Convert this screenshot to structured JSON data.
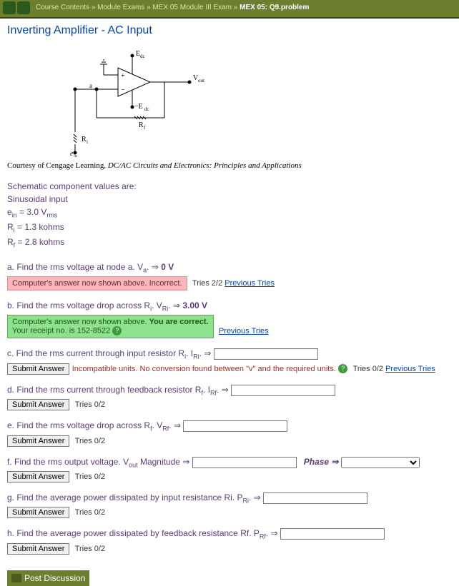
{
  "breadcrumb_raw": "Course Contents » Module Exams » MEX 05 Module III Exam »",
  "breadcrumb_current": "MEX 05: Q9.problem",
  "title": "Inverting Amplifier - AC Input",
  "credit_prefix": "Courtesy of Cengage Learning, ",
  "credit_italic": "DC/AC Circuits and Electronics: Principles and Applications",
  "schem": {
    "Edc": "E_dc",
    "nEdc": "−E_dc",
    "Vout": "V_out",
    "Rf": "R_f",
    "Ri": "R_i",
    "a": "a",
    "ein": "e_in"
  },
  "values": {
    "hdr": "Schematic component values are:",
    "l1": "Sinusoidal input",
    "l2a": "e",
    "l2sub": "in",
    "l2b": " = 3.0 V",
    "l2sub2": "rms",
    "l3a": "R",
    "l3sub": "i",
    "l3b": " = 1.3 kohms",
    "l4a": "R",
    "l4sub": "f",
    "l4b": " = 2.8 kohms"
  },
  "a": {
    "q": "a. Find the rms voltage at node a. V",
    "sub": "a",
    "tail": ". ⇒ ",
    "ans": "0 V",
    "fb": "Computer's answer now shown above. Incorrect.",
    "tries": "Tries 2/2",
    "prev": "Previous Tries"
  },
  "b": {
    "q": "b. Find the rms voltage drop across R",
    "sub": "i",
    "mid": ". V",
    "sub2": "Ri",
    "tail": ". ⇒ ",
    "ans": "3.00 V",
    "fb1": "Computer's answer now shown above. ",
    "fb2": "You are correct.",
    "fb3": "Your receipt no. is 152-8522",
    "prev": "Previous Tries"
  },
  "c": {
    "q": "c. Find the rms current through input resistor R",
    "sub": "i",
    "mid": ". I",
    "sub2": "Ri",
    "tail": ". ⇒",
    "btn": "Submit Answer",
    "err": "Incompatible units. No conversion found between \"v\" and the required units.",
    "tries": "Tries 0/2",
    "prev": "Previous Tries"
  },
  "d": {
    "q": "d. Find the rms current through feedback resistor R",
    "sub": "f",
    "mid": ". I",
    "sub2": "Rf",
    "tail": ". ⇒",
    "btn": "Submit Answer",
    "tries": "Tries 0/2"
  },
  "e": {
    "q": "e. Find the rms voltage drop across R",
    "sub": "f",
    "mid": ". V",
    "sub2": "Rf",
    "tail": ". ⇒",
    "btn": "Submit Answer",
    "tries": "Tries 0/2"
  },
  "f": {
    "q": "f. Find the rms output voltage. V",
    "sub": "out",
    "mid": " Magnitude ⇒",
    "phase": "Phase ⇒",
    "btn": "Submit Answer",
    "tries": "Tries 0/2"
  },
  "g": {
    "q": "g. Find the average power dissipated by input resistance Ri. P",
    "sub": "Ri",
    "tail": ". ⇒",
    "btn": "Submit Answer",
    "tries": "Tries 0/2"
  },
  "h": {
    "q": "h. Find the average power dissipated by feedback resistance Rf. P",
    "sub": "Rf",
    "tail": ". ⇒",
    "btn": "Submit Answer",
    "tries": "Tries 0/2"
  },
  "post": "Post Discussion"
}
